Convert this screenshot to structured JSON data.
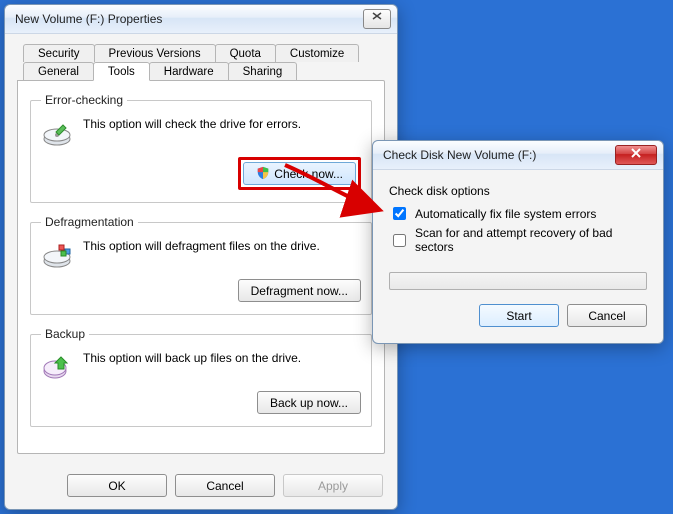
{
  "properties_window": {
    "title": "New Volume (F:) Properties",
    "tabs_row1": [
      "Security",
      "Previous Versions",
      "Quota",
      "Customize"
    ],
    "tabs_row2": [
      "General",
      "Tools",
      "Hardware",
      "Sharing"
    ],
    "active_tab": "Tools",
    "error_checking": {
      "legend": "Error-checking",
      "desc": "This option will check the drive for errors.",
      "button": "Check now..."
    },
    "defrag": {
      "legend": "Defragmentation",
      "desc": "This option will defragment files on the drive.",
      "button": "Defragment now..."
    },
    "backup": {
      "legend": "Backup",
      "desc": "This option will back up files on the drive.",
      "button": "Back up now..."
    },
    "ok": "OK",
    "cancel": "Cancel",
    "apply": "Apply"
  },
  "checkdisk_window": {
    "title": "Check Disk New Volume (F:)",
    "group_label": "Check disk options",
    "opt1": "Automatically fix file system errors",
    "opt1_checked": true,
    "opt2": "Scan for and attempt recovery of bad sectors",
    "opt2_checked": false,
    "start": "Start",
    "cancel": "Cancel"
  }
}
